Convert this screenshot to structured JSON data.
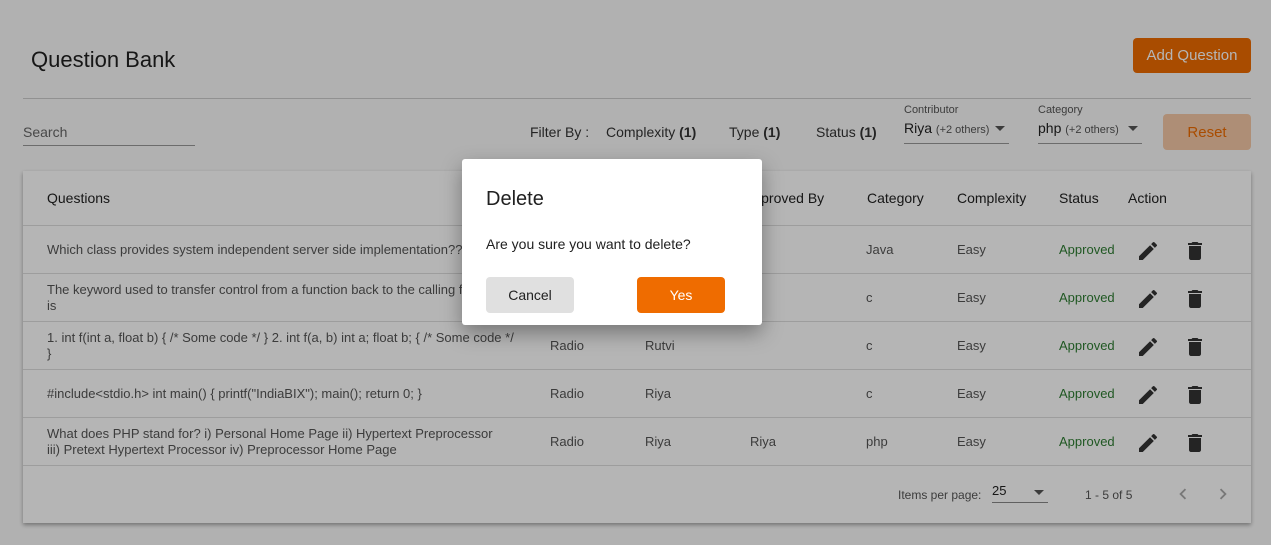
{
  "header": {
    "title": "Question Bank",
    "add_button": "Add Question"
  },
  "toolbar": {
    "search_placeholder": "Search",
    "filter_by": "Filter By :",
    "filters": [
      {
        "label": "Complexity",
        "count": "(1)"
      },
      {
        "label": "Type",
        "count": "(1)"
      },
      {
        "label": "Status",
        "count": "(1)"
      }
    ],
    "contributor": {
      "label": "Contributor",
      "value": "Riya",
      "extra": "(+2 others)"
    },
    "category": {
      "label": "Category",
      "value": "php",
      "extra": "(+2 others)"
    },
    "reset_button": "Reset"
  },
  "table": {
    "headers": {
      "questions": "Questions",
      "approved_by": "Approved By",
      "category": "Category",
      "complexity": "Complexity",
      "status": "Status",
      "action": "Action"
    },
    "rows": [
      {
        "question": "Which class provides system independent server side implementation??",
        "type": "",
        "contributor": "",
        "approved_by": "",
        "category": "Java",
        "complexity": "Easy",
        "status": "Approved"
      },
      {
        "question": "The keyword used to transfer control from a function back to the calling function is",
        "type": "",
        "contributor": "",
        "approved_by": "",
        "category": "c",
        "complexity": "Easy",
        "status": "Approved"
      },
      {
        "question": "1. int f(int a, float b) { /* Some code */ } 2. int f(a, b) int a; float b; { /* Some code */ }",
        "type": "Radio",
        "contributor": "Rutvi",
        "approved_by": "",
        "category": "c",
        "complexity": "Easy",
        "status": "Approved"
      },
      {
        "question": "#include<stdio.h> int main() { printf(\"IndiaBIX\"); main(); return 0; }",
        "type": "Radio",
        "contributor": "Riya",
        "approved_by": "",
        "category": "c",
        "complexity": "Easy",
        "status": "Approved"
      },
      {
        "question": "What does PHP stand for? i) Personal Home Page ii) Hypertext Preprocessor iii) Pretext Hypertext Processor iv) Preprocessor Home Page",
        "type": "Radio",
        "contributor": "Riya",
        "approved_by": "Riya",
        "category": "php",
        "complexity": "Easy",
        "status": "Approved"
      }
    ],
    "action_icons": [
      "edit-icon",
      "delete-icon"
    ]
  },
  "paginator": {
    "items_per_page_label": "Items per page:",
    "items_per_page": "25",
    "range": "1 - 5 of 5"
  },
  "dialog": {
    "title": "Delete",
    "message": "Are you sure you want to delete?",
    "cancel": "Cancel",
    "confirm": "Yes"
  },
  "colors": {
    "accent": "#ef6c00",
    "approved": "#2e7d32",
    "overlay": "rgba(0,0,0,0.29)"
  }
}
